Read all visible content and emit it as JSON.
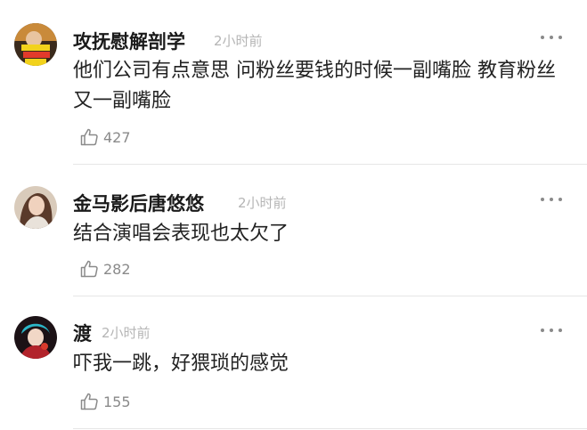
{
  "comments": [
    {
      "username": "攻抚慰解剖学",
      "time": "2小时前",
      "content": "他们公司有点意思 问粉丝要钱的时候一副嘴脸 教育粉丝又一副嘴脸",
      "likes": "427",
      "avatar": "avatar-image"
    },
    {
      "username": "金马影后唐悠悠",
      "time": "2小时前",
      "content": "结合演唱会表现也太欠了",
      "likes": "282",
      "avatar": "avatar-image"
    },
    {
      "username": "渡",
      "time": "2小时前",
      "content": "吓我一跳，好猥琐的感觉",
      "likes": "155",
      "avatar": "avatar-image"
    }
  ],
  "icons": {
    "like": "thumbs-up-icon",
    "more": "more-options-icon"
  },
  "colors": {
    "text": "#222222",
    "muted": "#b5b5b5",
    "icon": "#8a8a8a",
    "divider": "#e6e6e6"
  }
}
